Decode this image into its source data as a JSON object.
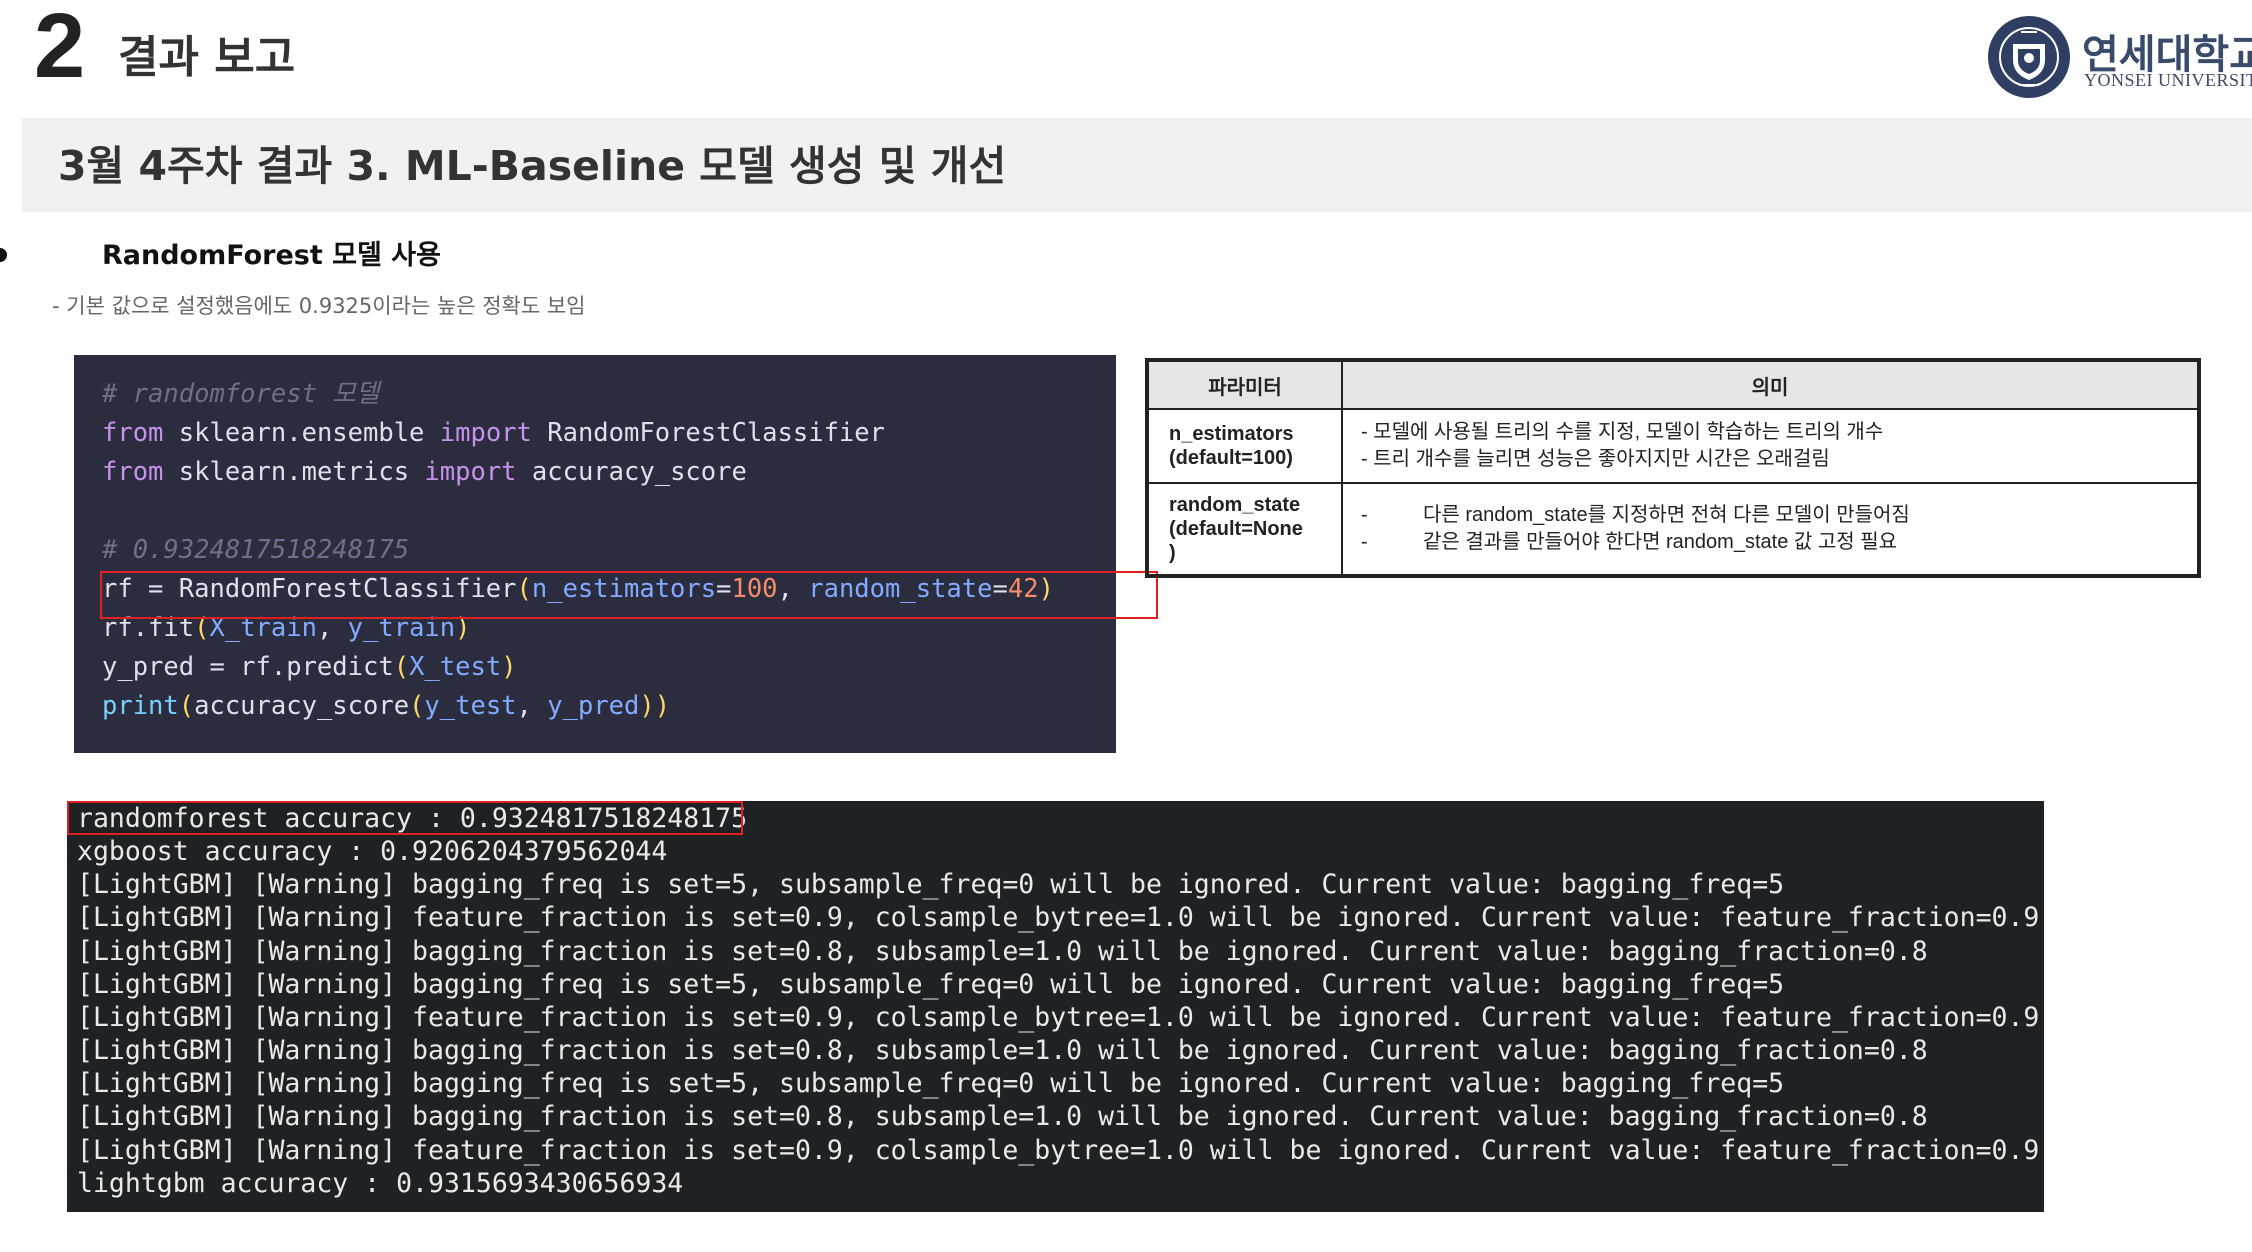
{
  "header": {
    "section_number": "2",
    "section_title": "결과 보고",
    "logo_kr": "연세대학교",
    "logo_en": "YONSEI UNIVERSITY"
  },
  "band": {
    "title": "3월 4주차 결과 3. ML-Baseline 모델 생성 및 개선"
  },
  "bullet": {
    "label": "RandomForest 모델 사용",
    "description": "- 기본 값으로 설정했음에도 0.9325이라는 높은 정확도 보임"
  },
  "code": {
    "c1": "# randomforest 모델",
    "l2_from": "from",
    "l2_mod": " sklearn.ensemble ",
    "l2_import": "import",
    "l2_name": " RandomForestClassifier",
    "l3_from": "from",
    "l3_mod": " sklearn.metrics ",
    "l3_import": "import",
    "l3_name": " accuracy_score",
    "c2": "# 0.9324817518248175",
    "l6_a": "rf = RandomForestClassifier",
    "l6_p1": "(",
    "l6_arg1": "n_estimators",
    "l6_eq1": "=",
    "l6_v1": "100",
    "l6_sep": ", ",
    "l6_arg2": "random_state",
    "l6_eq2": "=",
    "l6_v2": "42",
    "l6_p2": ")",
    "l7_a": "rf.fit",
    "l7_p1": "(",
    "l7_x": "X_train",
    "l7_sep": ", ",
    "l7_y": "y_train",
    "l7_p2": ")",
    "l8_a": "y_pred = rf.predict",
    "l8_p1": "(",
    "l8_x": "X_test",
    "l8_p2": ")",
    "l9_print": "print",
    "l9_p1": "(",
    "l9_fn": "accuracy_score",
    "l9_p2": "(",
    "l9_y1": "y_test",
    "l9_sep": ", ",
    "l9_y2": "y_pred",
    "l9_p3": ")",
    "l9_p4": ")"
  },
  "params_table": {
    "col_param": "파라미터",
    "col_meaning": "의미",
    "rows": [
      {
        "name_line1": "n_estimators",
        "name_line2": "(default=100)",
        "desc1": "- 모델에 사용될 트리의 수를 지정, 모델이 학습하는 트리의 개수",
        "desc2": "- 트리 개수를 늘리면 성능은 좋아지지만 시간은 오래걸림"
      },
      {
        "name_line1": "random_state",
        "name_line2": "(default=None",
        "name_line3": ")",
        "dash": "-",
        "desc1": "다른 random_state를 지정하면 전혀 다른 모델이 만들어짐",
        "desc2": "같은 결과를 만들어야 한다면 random_state 값 고정 필요"
      }
    ]
  },
  "terminal": {
    "lines": [
      "randomforest accuracy : 0.9324817518248175",
      "xgboost accuracy : 0.9206204379562044",
      "[LightGBM] [Warning] bagging_freq is set=5, subsample_freq=0 will be ignored. Current value: bagging_freq=5",
      "[LightGBM] [Warning] feature_fraction is set=0.9, colsample_bytree=1.0 will be ignored. Current value: feature_fraction=0.9",
      "[LightGBM] [Warning] bagging_fraction is set=0.8, subsample=1.0 will be ignored. Current value: bagging_fraction=0.8",
      "[LightGBM] [Warning] bagging_freq is set=5, subsample_freq=0 will be ignored. Current value: bagging_freq=5",
      "[LightGBM] [Warning] feature_fraction is set=0.9, colsample_bytree=1.0 will be ignored. Current value: feature_fraction=0.9",
      "[LightGBM] [Warning] bagging_fraction is set=0.8, subsample=1.0 will be ignored. Current value: bagging_fraction=0.8",
      "[LightGBM] [Warning] bagging_freq is set=5, subsample_freq=0 will be ignored. Current value: bagging_freq=5",
      "[LightGBM] [Warning] bagging_fraction is set=0.8, subsample=1.0 will be ignored. Current value: bagging_fraction=0.8",
      "[LightGBM] [Warning] feature_fraction is set=0.9, colsample_bytree=1.0 will be ignored. Current value: feature_fraction=0.9",
      "lightgbm accuracy : 0.9315693430656934"
    ]
  },
  "colors": {
    "highlight_border": "#e02020",
    "code_bg": "#2b2c3e",
    "terminal_bg": "#1f2224",
    "band_bg": "#f1f1f1"
  }
}
